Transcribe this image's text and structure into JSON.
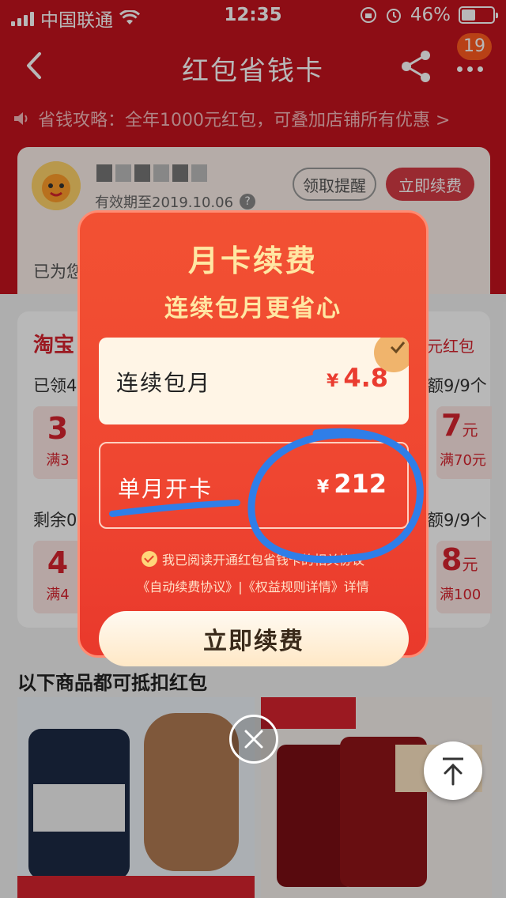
{
  "status_bar": {
    "carrier": "中国联通",
    "time": "12:35",
    "battery": "46%"
  },
  "navbar": {
    "title": "红包省钱卡",
    "badge_count": "19"
  },
  "tip": {
    "text": "省钱攻略：全年1000元红包，可叠加店铺所有优惠 >"
  },
  "member_card": {
    "expiry": "有效期至2019.10.06",
    "remind_button": "领取提醒",
    "renew_button": "立即续费",
    "saved_text": "已为您"
  },
  "coupons_section": {
    "title": "淘宝",
    "right_label": "元红包",
    "row1_left": "已领4",
    "row1_right": "额9/9个",
    "row2_left": "剩余0",
    "row2_right": "额9/9个",
    "coupon1": {
      "amount": "3",
      "cond": "满3"
    },
    "coupon2": {
      "amount": "4",
      "cond": "满4"
    },
    "coupon3": {
      "amount": "7",
      "unit": "元",
      "cond": "满70元"
    },
    "coupon4": {
      "amount": "8",
      "unit": "元",
      "cond": "满100"
    }
  },
  "products": {
    "title": "以下商品都可抵扣红包"
  },
  "modal": {
    "title": "月卡续费",
    "subtitle": "连续包月更省心",
    "options": [
      {
        "label": "连续包月",
        "currency": "¥",
        "price": "4.8",
        "selected": true
      },
      {
        "label": "单月开卡",
        "currency": "¥",
        "price": "212",
        "selected": false
      }
    ],
    "agreement": "我已阅读开通红包省钱卡的相关协议",
    "links": "《自动续费协议》|《权益规则详情》详情",
    "cta": "立即续费"
  },
  "colors": {
    "brand_red": "#c4131e",
    "modal_red": "#ef4631",
    "price_red": "#ea3c30",
    "annotation_blue": "#2f7ee8"
  },
  "icons": [
    "back-arrow-icon",
    "share-icon",
    "more-icon",
    "speaker-icon",
    "help-icon",
    "check-icon",
    "close-icon",
    "back-to-top-icon"
  ]
}
